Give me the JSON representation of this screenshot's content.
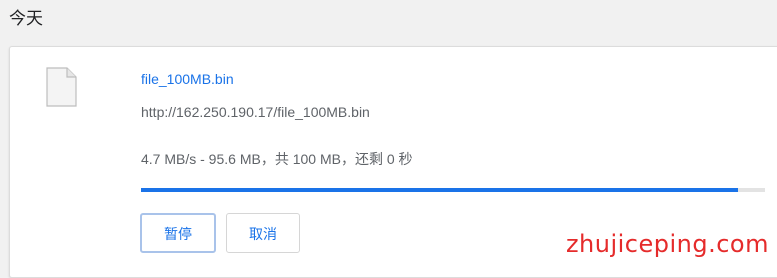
{
  "section": {
    "title": "今天"
  },
  "download": {
    "file_name": "file_100MB.bin",
    "url": "http://162.250.190.17/file_100MB.bin",
    "status_text": "4.7 MB/s - 95.6 MB，共 100 MB，还剩 0 秒",
    "progress_percent": 95.6,
    "pause_label": "暂停",
    "cancel_label": "取消",
    "icon": "file-icon"
  },
  "watermark": {
    "text": "zhujiceping.com"
  },
  "colors": {
    "accent": "#1a73e8",
    "watermark": "#e52b2b"
  }
}
